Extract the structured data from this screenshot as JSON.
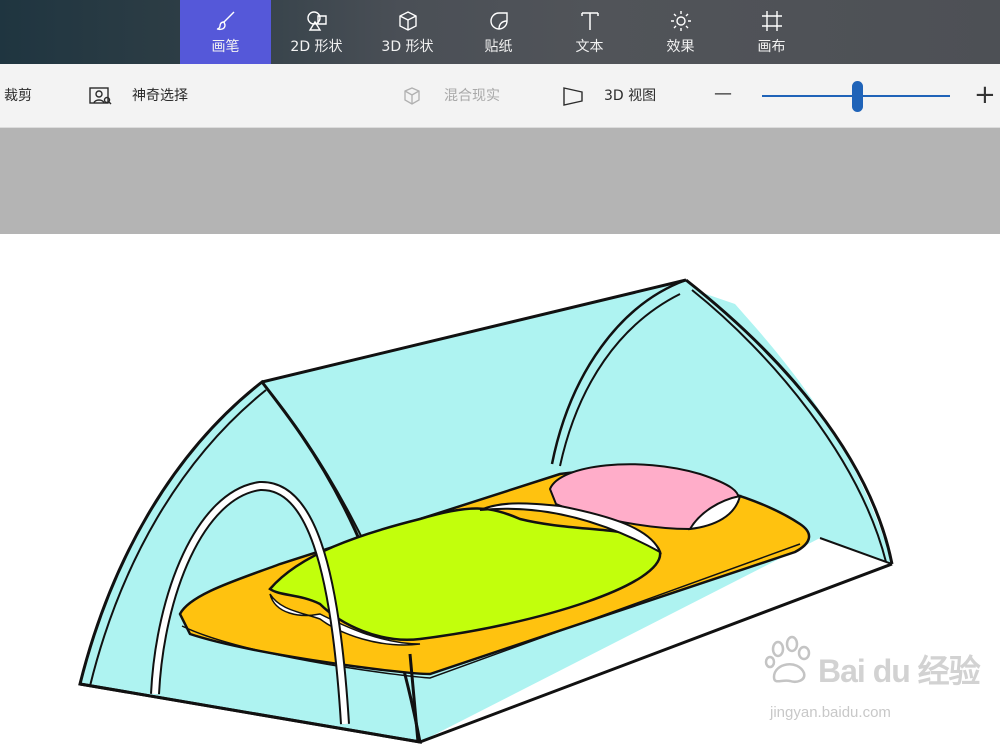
{
  "toolbar": {
    "tools": [
      {
        "label": "画笔",
        "icon": "brush-icon",
        "active": true
      },
      {
        "label": "2D 形状",
        "icon": "shapes-2d-icon"
      },
      {
        "label": "3D 形状",
        "icon": "cube-icon"
      },
      {
        "label": "贴纸",
        "icon": "sticker-icon"
      },
      {
        "label": "文本",
        "icon": "text-icon"
      },
      {
        "label": "效果",
        "icon": "sun-icon"
      },
      {
        "label": "画布",
        "icon": "canvas-crop-icon"
      }
    ],
    "active_color": "#5558d9"
  },
  "subbar": {
    "crop": "裁剪",
    "magic_select": "神奇选择",
    "mixed_reality": "混合现实",
    "view_3d": "3D 视图",
    "zoom_minus": "—",
    "zoom_plus": "+",
    "zoom_level": 0.48,
    "accent": "#1f63b8"
  },
  "canvas": {
    "colors": {
      "tent": "#aef3f1",
      "mattress": "#ffc20f",
      "blanket": "#c2ff0c",
      "pillow": "#ffadc9"
    }
  },
  "watermark": {
    "brand": "Bai du 经验",
    "url": "jingyan.baidu.com"
  }
}
